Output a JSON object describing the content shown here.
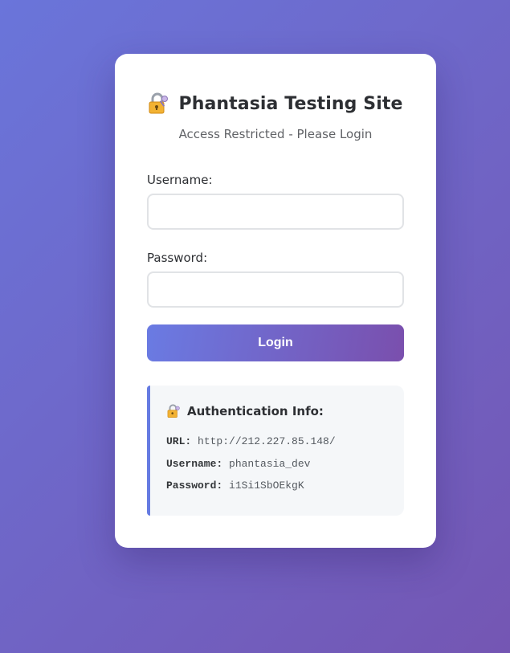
{
  "header": {
    "title": "Phantasia Testing Site",
    "subtitle": "Access Restricted - Please Login",
    "icon": "lock-with-key-icon"
  },
  "form": {
    "username_label": "Username:",
    "username_value": "",
    "password_label": "Password:",
    "password_value": "",
    "login_label": "Login"
  },
  "auth_info": {
    "title": "Authentication Info:",
    "icon": "lock-with-key-icon",
    "url_label": "URL:",
    "url_value": "http://212.227.85.148/",
    "username_label": "Username:",
    "username_value": "phantasia_dev",
    "password_label": "Password:",
    "password_value": "i1Si1SbOEkgK"
  },
  "colors": {
    "background_start": "#6a75da",
    "background_end": "#7456b3",
    "button_start": "#6a7be3",
    "button_end": "#7a4fad",
    "info_accent": "#667be2"
  }
}
